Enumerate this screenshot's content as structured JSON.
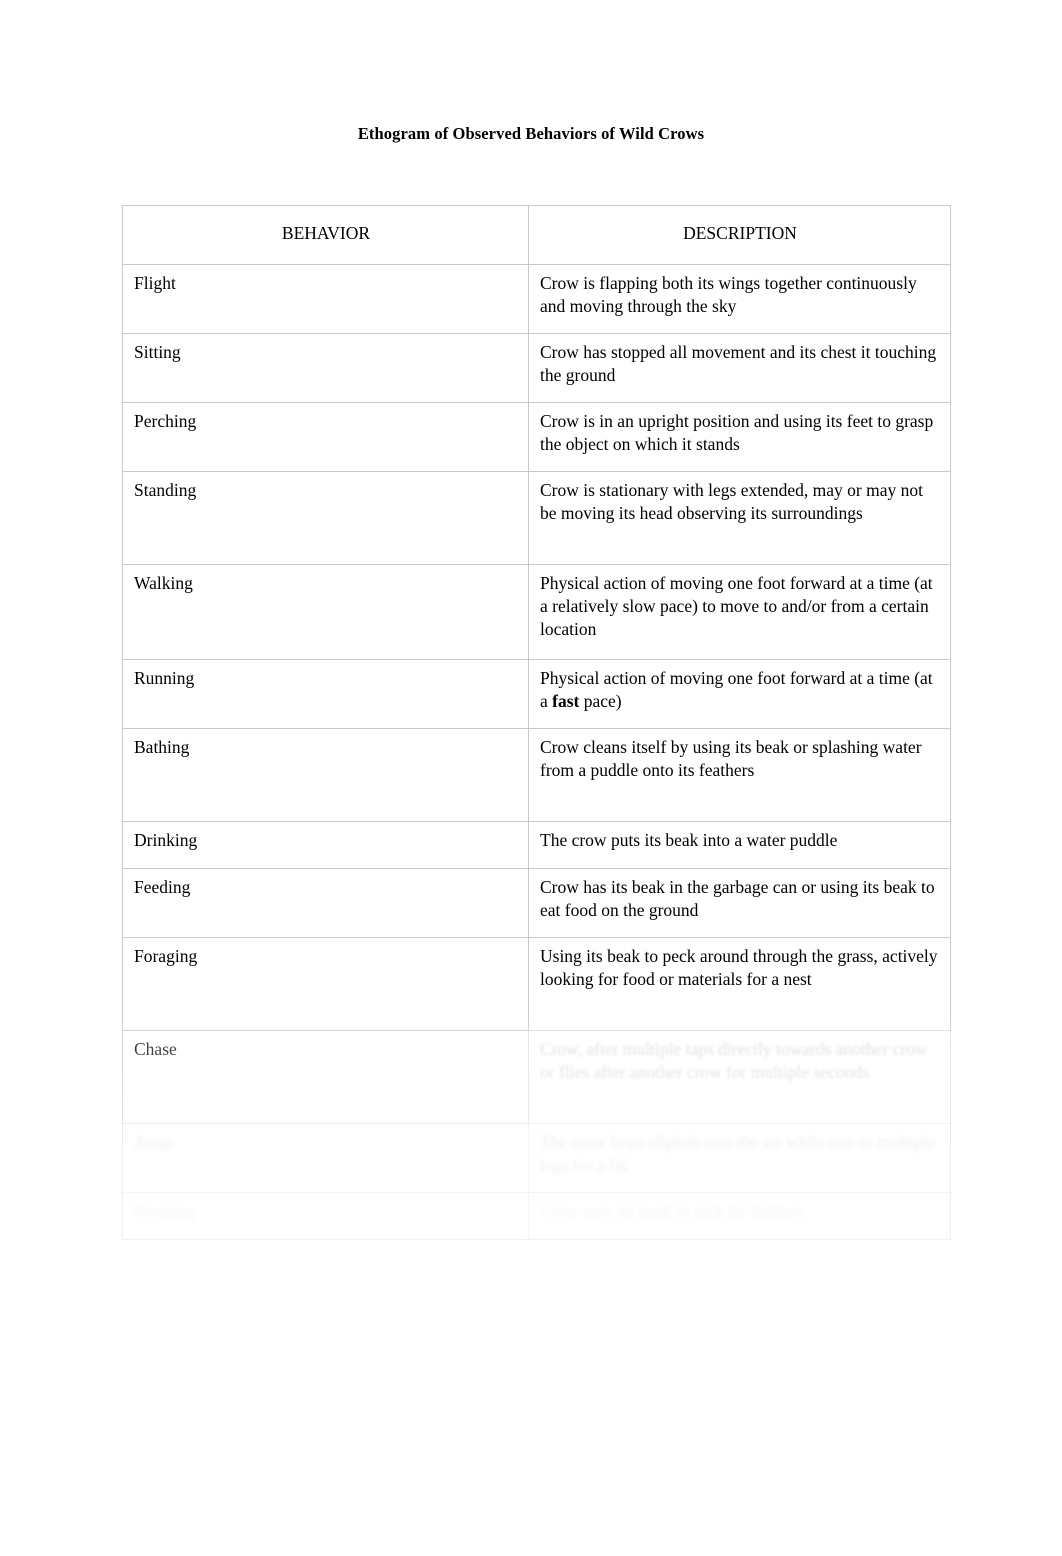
{
  "document": {
    "title": "Ethogram of Observed Behaviors of Wild Crows"
  },
  "table": {
    "headers": {
      "behavior": "BEHAVIOR",
      "description": "DESCRIPTION"
    },
    "block_1_rows": [
      {
        "behavior": "Flight",
        "description": "Crow is flapping both its wings together continuously and moving through the sky"
      },
      {
        "behavior": "Sitting",
        "description": "Crow has stopped all movement and its chest it touching the ground"
      },
      {
        "behavior": "Perching",
        "description": "Crow is in an upright position and using its feet to grasp the object on which it stands"
      },
      {
        "behavior": "Standing",
        "description": "Crow is stationary with legs extended, may or may not be moving its head observing its surroundings"
      },
      {
        "behavior": "Walking",
        "description": "Physical action of moving one foot forward at a time (at a relatively slow pace) to move to and/or from a certain location"
      }
    ],
    "block_2_rows": [
      {
        "behavior": "Running",
        "description_before": "Physical action of moving one foot forward at a time (at a ",
        "description_bold": "fast",
        "description_after": " pace)"
      },
      {
        "behavior": "Bathing",
        "description": "Crow cleans itself by using its beak or splashing water from a puddle onto its feathers"
      },
      {
        "behavior": "Drinking",
        "description": "The crow puts its beak into a water puddle"
      },
      {
        "behavior": "Feeding",
        "description": "Crow has its beak in the garbage can or using its beak to eat food on the ground"
      },
      {
        "behavior": "Foraging",
        "description": "Using its beak to peck around through the grass, actively looking for food or materials for a nest"
      },
      {
        "behavior": "Chase",
        "description": "Crow, after multiple taps directly towards another crow or flies after another crow for multiple seconds"
      },
      {
        "behavior": "Jump",
        "description": "The crow hops slightly into the air while one or multiple legs for a bit"
      },
      {
        "behavior": "Preening",
        "description": "Crow uses its beak to pick its feathers"
      }
    ]
  }
}
